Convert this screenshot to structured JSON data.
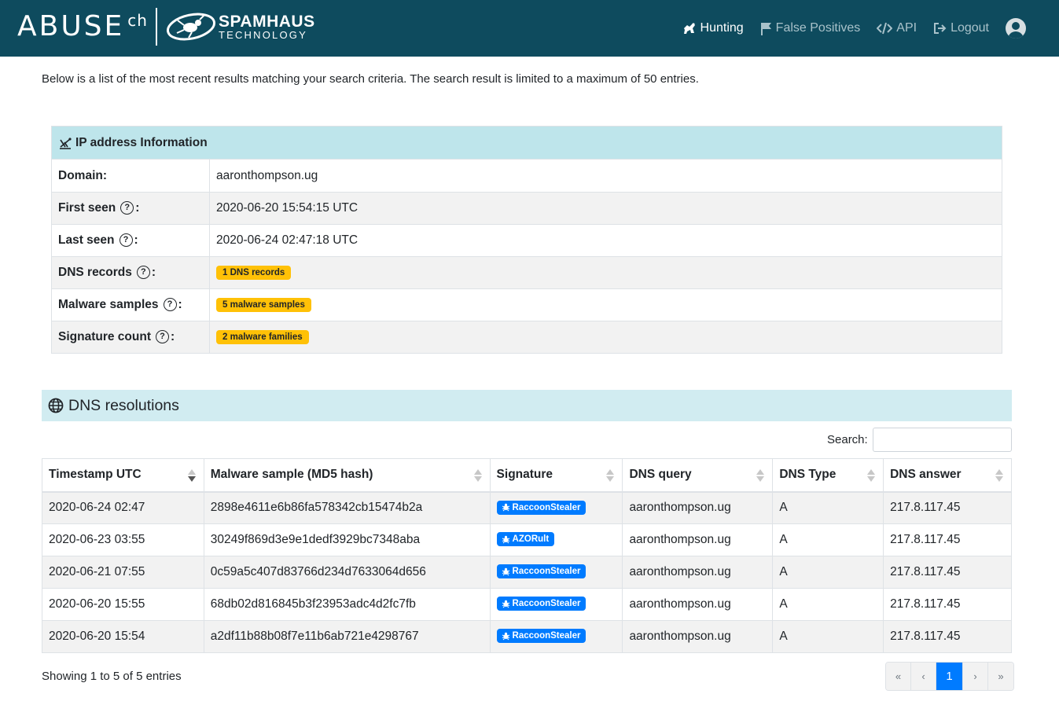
{
  "navbar": {
    "brand_abuse": "ABUSE",
    "brand_ch": "ch",
    "brand_spamhaus": "SPAMHAUS",
    "brand_technology": "TECHNOLOGY",
    "items": [
      {
        "label": "Hunting",
        "icon": "hunting-icon",
        "active": true
      },
      {
        "label": "False Positives",
        "icon": "flag-icon",
        "active": false
      },
      {
        "label": "API",
        "icon": "code-icon",
        "active": false
      },
      {
        "label": "Logout",
        "icon": "sign-out-icon",
        "active": false
      }
    ],
    "avatar_icon": "user-avatar-icon"
  },
  "intro_text": "Below is a list of the most recent results matching your search criteria. The search result is limited to a maximum of 50 entries.",
  "ip_info": {
    "title": "IP address Information",
    "rows": [
      {
        "label": "Domain:",
        "value": "aaronthompson.ug"
      },
      {
        "label": "First seen",
        "suffix": ":",
        "value": "2020-06-20 15:54:15 UTC"
      },
      {
        "label": "Last seen",
        "suffix": ":",
        "value": "2020-06-24 02:47:18 UTC"
      },
      {
        "label": "DNS records",
        "suffix": ":",
        "badge": "1 DNS records"
      },
      {
        "label": "Malware samples",
        "suffix": ":",
        "badge": "5 malware samples"
      },
      {
        "label": "Signature count",
        "suffix": ":",
        "badge": "2 malware families"
      }
    ],
    "help_glyph": "?"
  },
  "dns": {
    "title": "DNS resolutions",
    "search_label": "Search:",
    "search_value": "",
    "columns": [
      "Timestamp UTC",
      "Malware sample (MD5 hash)",
      "Signature",
      "DNS query",
      "DNS Type",
      "DNS answer"
    ],
    "rows": [
      {
        "timestamp": "2020-06-24 02:47",
        "md5": "2898e4611e6b86fa578342cb15474b2a",
        "signature": "RaccoonStealer",
        "query": "aaronthompson.ug",
        "type": "A",
        "answer": "217.8.117.45"
      },
      {
        "timestamp": "2020-06-23 03:55",
        "md5": "30249f869d3e9e1dedf3929bc7348aba",
        "signature": "AZORult",
        "query": "aaronthompson.ug",
        "type": "A",
        "answer": "217.8.117.45"
      },
      {
        "timestamp": "2020-06-21 07:55",
        "md5": "0c59a5c407d83766d234d7633064d656",
        "signature": "RaccoonStealer",
        "query": "aaronthompson.ug",
        "type": "A",
        "answer": "217.8.117.45"
      },
      {
        "timestamp": "2020-06-20 15:55",
        "md5": "68db02d816845b3f23953adc4d2fc7fb",
        "signature": "RaccoonStealer",
        "query": "aaronthompson.ug",
        "type": "A",
        "answer": "217.8.117.45"
      },
      {
        "timestamp": "2020-06-20 15:54",
        "md5": "a2df11b88b08f7e11b6ab721e4298767",
        "signature": "RaccoonStealer",
        "query": "aaronthompson.ug",
        "type": "A",
        "answer": "217.8.117.45"
      }
    ],
    "info": "Showing 1 to 5 of 5 entries",
    "pagination": {
      "first": "«",
      "prev": "‹",
      "current": "1",
      "next": "›",
      "last": "»"
    }
  },
  "colors": {
    "navbar": "#0e4b5e",
    "info_header": "#bee5eb",
    "dns_header": "#d1ecf1",
    "badge_warning": "#ffc107",
    "badge_primary": "#007bff"
  }
}
